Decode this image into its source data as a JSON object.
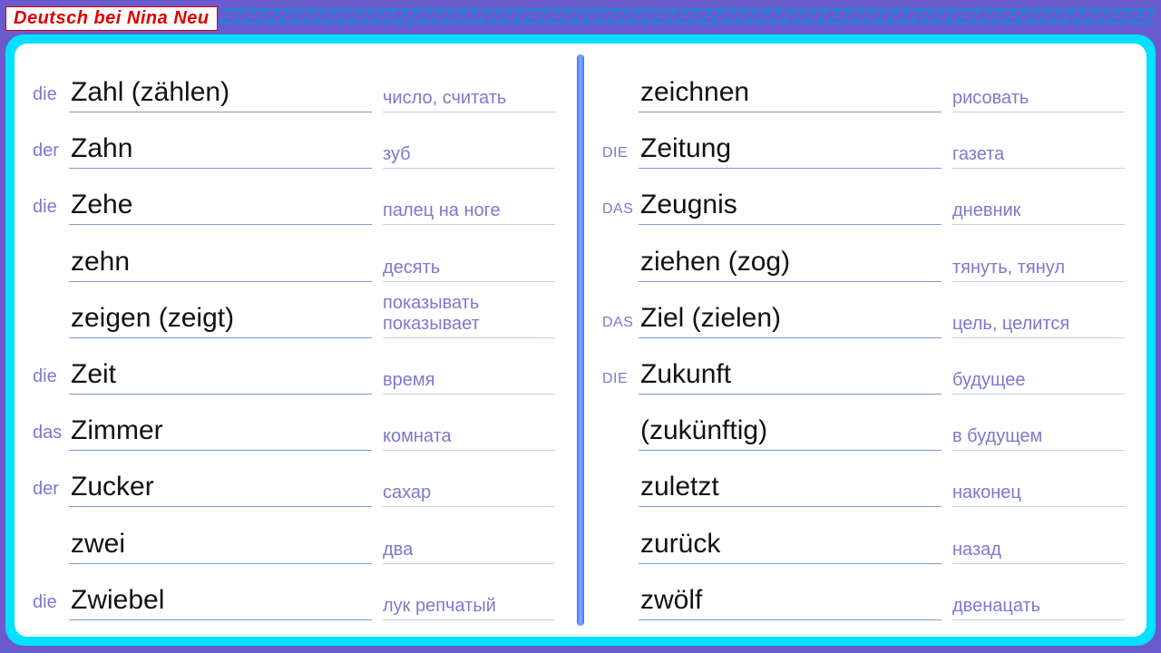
{
  "header": {
    "title": "Deutsch bei Nina Neu",
    "z_strip": "ZZZZZZZZZZZZZZZZZZZZZZZZZZZZZZZZZZZZZZZZZZZZZZZZZZZZZZZZZZZZZZZZZZZZZZZZZZZZZZZZZZZZZZZ"
  },
  "left": [
    {
      "article": "die",
      "german": "Zahl (zählen)",
      "trans": "число, считать"
    },
    {
      "article": "der",
      "german": "Zahn",
      "trans": "зуб"
    },
    {
      "article": "die",
      "german": "Zehe",
      "trans": "палец на ноге"
    },
    {
      "article": "",
      "german": "zehn",
      "trans": "десять"
    },
    {
      "article": "",
      "german": "zeigen (zeigt)",
      "trans": "показывать\nпоказывает"
    },
    {
      "article": "die",
      "german": "Zeit",
      "trans": "время"
    },
    {
      "article": "das",
      "german": "Zimmer",
      "trans": "комната"
    },
    {
      "article": "der",
      "german": "Zucker",
      "trans": "сахар"
    },
    {
      "article": "",
      "german": "zwei",
      "trans": "два"
    },
    {
      "article": "die",
      "german": "Zwiebel",
      "trans": "лук репчатый"
    }
  ],
  "right": [
    {
      "article": "",
      "german": "zeichnen",
      "trans": "рисовать"
    },
    {
      "article": "die",
      "caps": true,
      "german": "Zeitung",
      "trans": "газета"
    },
    {
      "article": "das",
      "caps": true,
      "german": "Zeugnis",
      "trans": "дневник"
    },
    {
      "article": "",
      "german": "ziehen (zog)",
      "trans": "тянуть, тянул"
    },
    {
      "article": "das",
      "caps": true,
      "german": "Ziel (zielen)",
      "trans": "цель, целится"
    },
    {
      "article": "die",
      "caps": true,
      "german": "Zukunft",
      "trans": "будущее"
    },
    {
      "article": "",
      "german": "(zukünftig)",
      "trans": "в будущем"
    },
    {
      "article": "",
      "german": "zuletzt",
      "trans": "наконец"
    },
    {
      "article": "",
      "german": "zurück",
      "trans": "назад"
    },
    {
      "article": "",
      "german": "zwölf",
      "trans": "двенацать"
    }
  ]
}
